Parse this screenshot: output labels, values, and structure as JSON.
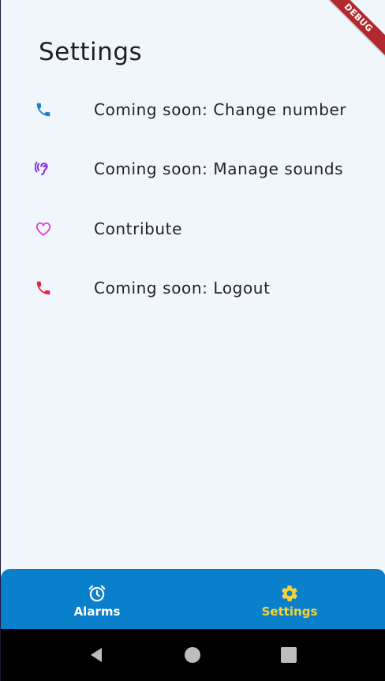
{
  "page": {
    "title": "Settings"
  },
  "debug_banner": {
    "label": "DEBUG",
    "color": "#b3282d"
  },
  "settings_items": [
    {
      "label": "Coming soon: Change number",
      "icon": "phone-icon",
      "icon_color": "#1a7fd1"
    },
    {
      "label": "Coming soon: Manage sounds",
      "icon": "ear-icon",
      "icon_color": "#8a2be2"
    },
    {
      "label": "Contribute",
      "icon": "heart-icon",
      "icon_color": "#e23fd0"
    },
    {
      "label": "Coming soon: Logout",
      "icon": "phone-hangup-icon",
      "icon_color": "#e0284a"
    }
  ],
  "bottom_nav": {
    "background": "#0a7fcb",
    "items": [
      {
        "label": "Alarms",
        "icon": "alarm-clock-icon",
        "color": "#ffffff",
        "selected": false
      },
      {
        "label": "Settings",
        "icon": "gear-icon",
        "color": "#f5d33b",
        "selected": true
      }
    ]
  },
  "system_nav": {
    "buttons": [
      "back-icon",
      "home-icon",
      "recents-icon"
    ]
  }
}
